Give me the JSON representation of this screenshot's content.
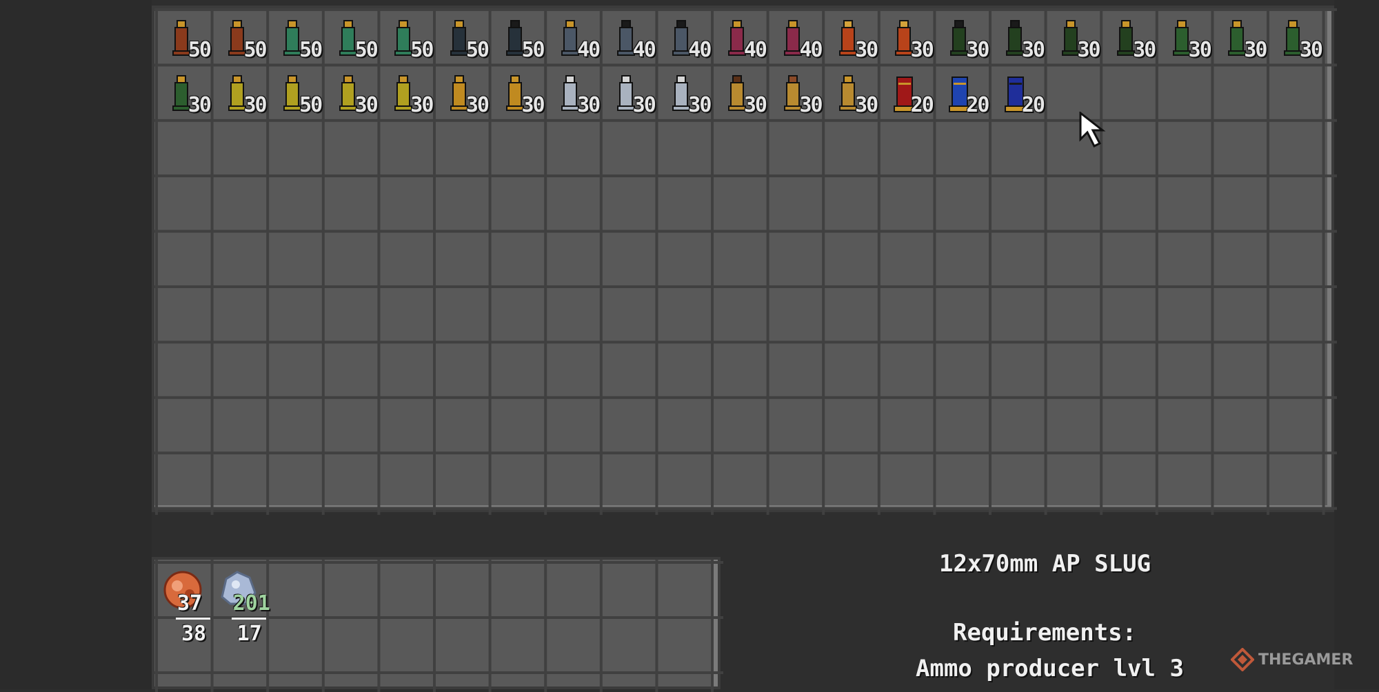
{
  "ammo_slots": [
    {
      "qty": "50",
      "body": "#8a3a1c",
      "tip": "#c9952a"
    },
    {
      "qty": "50",
      "body": "#8a3a1c",
      "tip": "#c9952a"
    },
    {
      "qty": "50",
      "body": "#2f7d5a",
      "tip": "#c9952a"
    },
    {
      "qty": "50",
      "body": "#2f7d5a",
      "tip": "#c9952a"
    },
    {
      "qty": "50",
      "body": "#2f7d5a",
      "tip": "#c9952a"
    },
    {
      "qty": "50",
      "body": "#26313a",
      "tip": "#c9952a"
    },
    {
      "qty": "50",
      "body": "#26313a",
      "tip": "#1a1a1a"
    },
    {
      "qty": "40",
      "body": "#4b5766",
      "tip": "#c9952a"
    },
    {
      "qty": "40",
      "body": "#4b5766",
      "tip": "#1a1a1a"
    },
    {
      "qty": "40",
      "body": "#4b5766",
      "tip": "#1a1a1a"
    },
    {
      "qty": "40",
      "body": "#8a2a4a",
      "tip": "#c9952a"
    },
    {
      "qty": "40",
      "body": "#8a2a4a",
      "tip": "#c9952a"
    },
    {
      "qty": "30",
      "body": "#b8431a",
      "tip": "#d4a23a"
    },
    {
      "qty": "30",
      "body": "#b8431a",
      "tip": "#d4a23a"
    },
    {
      "qty": "30",
      "body": "#23401f",
      "tip": "#1a1a1a"
    },
    {
      "qty": "30",
      "body": "#23401f",
      "tip": "#1a1a1a"
    },
    {
      "qty": "30",
      "body": "#23401f",
      "tip": "#c9952a"
    },
    {
      "qty": "30",
      "body": "#23401f",
      "tip": "#c9952a"
    },
    {
      "qty": "30",
      "body": "#2c5e2e",
      "tip": "#c9952a"
    },
    {
      "qty": "30",
      "body": "#2c5e2e",
      "tip": "#c9952a"
    },
    {
      "qty": "30",
      "body": "#2c5e2e",
      "tip": "#c9952a"
    },
    {
      "qty": "30",
      "body": "#2c5e2e",
      "tip": "#c9952a"
    },
    {
      "qty": "30",
      "body": "#b0a020",
      "tip": "#c9952a"
    },
    {
      "qty": "50",
      "body": "#b0a020",
      "tip": "#c9952a"
    },
    {
      "qty": "30",
      "body": "#b0a020",
      "tip": "#c9952a"
    },
    {
      "qty": "30",
      "body": "#b0a020",
      "tip": "#c9952a"
    },
    {
      "qty": "30",
      "body": "#c08a20",
      "tip": "#c9952a"
    },
    {
      "qty": "30",
      "body": "#c08a20",
      "tip": "#c9952a"
    },
    {
      "qty": "30",
      "body": "#a9b2bf",
      "tip": "#d6d6d6"
    },
    {
      "qty": "30",
      "body": "#a9b2bf",
      "tip": "#d6d6d6"
    },
    {
      "qty": "30",
      "body": "#a9b2bf",
      "tip": "#d6d6d6"
    },
    {
      "qty": "30",
      "body": "#b88a30",
      "tip": "#5a3018"
    },
    {
      "qty": "30",
      "body": "#b88a30",
      "tip": "#8a4a28"
    },
    {
      "qty": "30",
      "body": "#b88a30",
      "tip": "#c9952a"
    },
    {
      "qty": "20",
      "body": "#a01818",
      "tip": "#c9952a"
    },
    {
      "qty": "20",
      "body": "#1f44b0",
      "tip": "#c9952a"
    },
    {
      "qty": "20",
      "body": "#1f2e9a",
      "tip": "#1a1a1a"
    }
  ],
  "resources": [
    {
      "have": "37",
      "need": "38",
      "have_color": "#f2f2f2",
      "icon": "scrap-metal-icon",
      "icon_color": "#d86a3c"
    },
    {
      "have": "201",
      "need": "17",
      "have_color": "#9fd39f",
      "icon": "steel-ore-icon",
      "icon_color": "#a9b9d6"
    }
  ],
  "selected_item": {
    "name": "12x70mm AP SLUG",
    "requirements_label": "Requirements:",
    "requirement": "Ammo producer lvl 3"
  },
  "watermark": "THEGAMER"
}
